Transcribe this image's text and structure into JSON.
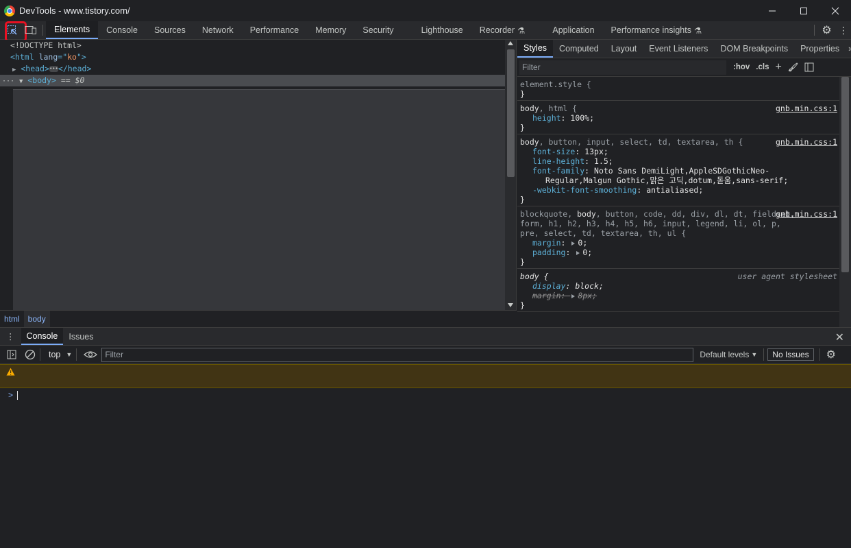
{
  "window": {
    "title": "DevTools - www.tistory.com/",
    "controls": [
      "minimize",
      "maximize",
      "close"
    ]
  },
  "main_tabs": [
    {
      "label": "Elements",
      "active": true
    },
    {
      "label": "Console"
    },
    {
      "label": "Sources"
    },
    {
      "label": "Network"
    },
    {
      "label": "Performance"
    },
    {
      "label": "Memory"
    },
    {
      "label": "Security"
    },
    {
      "label": "Lighthouse"
    },
    {
      "label": "Recorder"
    },
    {
      "label": "Application"
    },
    {
      "label": "Performance insights"
    }
  ],
  "dom": {
    "doctype": "<!DOCTYPE html>",
    "html_open": "<html",
    "html_attr_name": "lang",
    "html_attr_eq": "=\"",
    "html_attr_value": "ko",
    "html_attr_close": "\">",
    "head_open": "<head>",
    "head_close": "</head>",
    "body_tag": "<body>",
    "body_suffix": " == $0"
  },
  "breadcrumbs": [
    "html",
    "body"
  ],
  "styles_tabs": [
    "Styles",
    "Computed",
    "Layout",
    "Event Listeners",
    "DOM Breakpoints",
    "Properties"
  ],
  "styles_filter": {
    "placeholder": "Filter",
    "hov": ":hov",
    "cls": ".cls"
  },
  "rules": {
    "r0": {
      "selector": "element.style {",
      "close": "}"
    },
    "r1": {
      "sel_main": "body",
      "sel_rest": ", html {",
      "source": "gnb.min.css:1",
      "close": "}",
      "d1_name": "height",
      "d1_val": "100%;"
    },
    "r2": {
      "sel_main": "body",
      "sel_rest": ", button, input, select, td, textarea, th {",
      "source": "gnb.min.css:1",
      "close": "}",
      "d1_name": "font-size",
      "d1_val": "13px;",
      "d2_name": "line-height",
      "d2_val": "1.5;",
      "d3_name": "font-family",
      "d3_val": "Noto Sans DemiLight,AppleSDGothicNeo-Regular,Malgun Gothic,맑은 고딕,dotum,돋움,sans-serif;",
      "d4_name": "-webkit-font-smoothing",
      "d4_val": "antialiased;"
    },
    "r3": {
      "sel_pre": "blockquote, ",
      "sel_main": "body",
      "sel_rest": ", button, code, dd, div, dl, dt, fieldset, form, h1, h2, h3, h4, h5, h6, input, legend, li, ol, p, pre, select, td, textarea, th, ul {",
      "source": "gnb.min.css:1",
      "close": "}",
      "d1_name": "margin",
      "d1_val": "0;",
      "d2_name": "padding",
      "d2_val": "0;"
    },
    "r4": {
      "sel_main": "body",
      "sel_rest": " {",
      "source": "user agent stylesheet",
      "close": "}",
      "d1_name": "display",
      "d1_val": "block;",
      "d2_name": "margin",
      "d2_val": "8px;"
    }
  },
  "drawer_tabs": [
    {
      "label": "Console",
      "active": true
    },
    {
      "label": "Issues"
    }
  ],
  "console": {
    "context": "top",
    "filter_placeholder": "Filter",
    "levels": "Default levels",
    "issues": "No Issues",
    "prompt": ">"
  },
  "colors": {
    "accent": "#7cacf8",
    "highlight": "#e81123",
    "warning_bg": "#413414"
  }
}
